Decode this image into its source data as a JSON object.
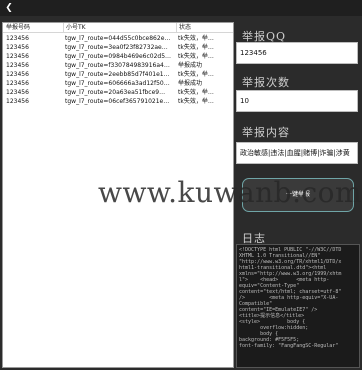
{
  "table": {
    "headers": [
      "举报号码",
      "小号TK",
      "状态"
    ],
    "rows": [
      {
        "qq": "123456",
        "tk": "tgw_l7_route=044d55c0bce862e…",
        "status": "tk失效，举…"
      },
      {
        "qq": "123456",
        "tk": "tgw_l7_route=3ea0f23f82732ae…",
        "status": "tk失效，举…"
      },
      {
        "qq": "123456",
        "tk": "tgw_l7_route=0984b469e6c02d5…",
        "status": "tk失效，举…"
      },
      {
        "qq": "123456",
        "tk": "tgw_l7_route=f330784983916a4…",
        "status": "举报成功"
      },
      {
        "qq": "123456",
        "tk": "tgw_l7_route=2eebb85d7f401e1…",
        "status": "tk失效，举…"
      },
      {
        "qq": "123456",
        "tk": "tgw_l7_route=606666a3ad12f50…",
        "status": "举报成功"
      },
      {
        "qq": "123456",
        "tk": "tgw_l7_route=20a63ea51fbce9…",
        "status": "tk失效，举…"
      },
      {
        "qq": "123456",
        "tk": "tgw_l7_route=06cef365791021e…",
        "status": "tk失效，举…"
      }
    ]
  },
  "form": {
    "qq_title": "举报QQ",
    "qq_value": "123456",
    "count_title": "举报次数",
    "count_value": "10",
    "content_title": "举报内容",
    "content_value": "政治敏感|违法|血腥|赌博|诈骗|涉黄",
    "report_button": "一键举报"
  },
  "log": {
    "title": "日志",
    "text": "<!DOCTYPE html PUBLIC \"-//W3C//DTD\nXHTML 1.0 Transitional//EN\"\n\"http://www.w3.org/TR/xhtml1/DTD/x\nhtml1-transitional.dtd\"><html\nxmlns=\"http://www.w3.org/1999/xhtm\nl\">    <head>      <meta http-\nequiv=\"Content-Type\"\ncontent=\"text/html; charset=utf-8\"\n/>        <meta http-equiv=\"X-UA-\nCompatible\"\ncontent=\"IE=EmulateIE7\" />\n<title>提示信息</title>\n<style>         body {\n       overflow:hidden;\n       body {\nbackground: #F5F5F5;\nfont-family: \"FangFangSC-Regular\""
  },
  "watermark": "www.kuwanb.com",
  "icons": {
    "back": "back-arrow-icon"
  }
}
